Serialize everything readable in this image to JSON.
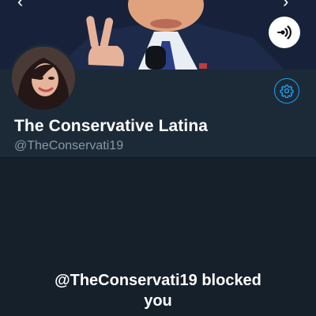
{
  "profile": {
    "display_name": "The Conservative Latina",
    "handle": "@TheConservati19"
  },
  "blocked_notice": {
    "line1": "@TheConservati19 blocked",
    "line2": "you"
  },
  "icons": {
    "back": "chevron-left-icon",
    "forward": "chevron-right-icon",
    "podcast": "podcast-icon",
    "settings": "gear-icon"
  },
  "colors": {
    "background": "#15202b",
    "header_panel": "#1c2a38",
    "accent": "#1da1f2",
    "secondary_text": "#8899a6"
  }
}
